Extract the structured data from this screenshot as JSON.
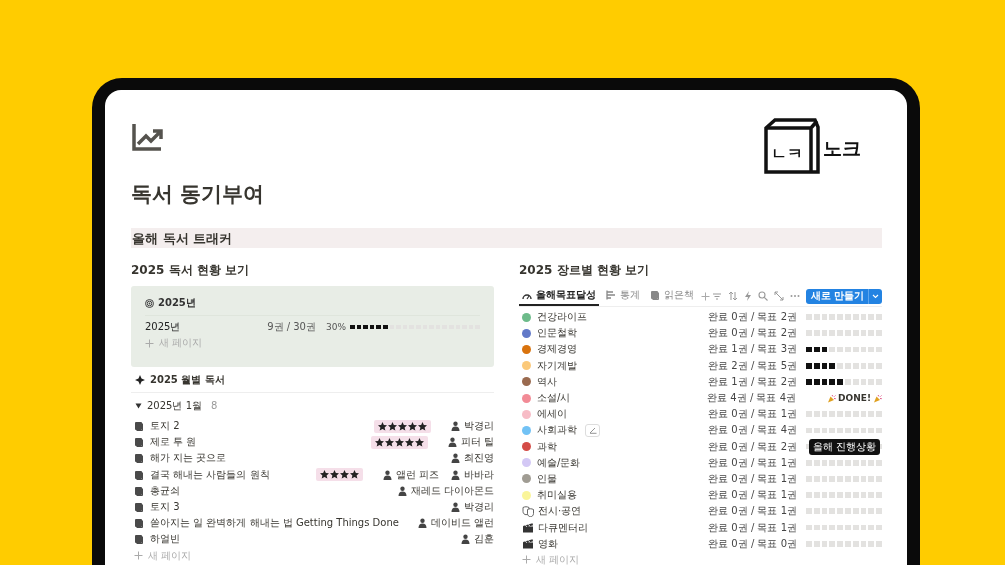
{
  "logo": {
    "symbol": "ㄴㅋ",
    "text": "노크"
  },
  "page": {
    "title": "독서 동기부여",
    "banner": "올해 독서 트래커"
  },
  "yearly": {
    "heading": "2025 독서 현황 보기",
    "view": "2025년",
    "rows": [
      {
        "name": "2025년",
        "count": "9권 / 30권",
        "percent": "30%",
        "level": 0.3
      }
    ],
    "add": "새 페이지"
  },
  "monthly": {
    "view": "2025 월별 독서",
    "groups": [
      {
        "label": "2025년 1월",
        "count": "8",
        "expanded": true,
        "books": [
          {
            "title": "토지 2",
            "stars": 5,
            "authors": [
              "박경리"
            ]
          },
          {
            "title": "제로 투 원",
            "stars": 5,
            "authors": [
              "피터 틸"
            ]
          },
          {
            "title": "해가 지는 곳으로",
            "authors": [
              "최진영"
            ]
          },
          {
            "title": "결국 해내는 사람들의 원칙",
            "stars": 4,
            "authors": [
              "앨런 피즈",
              "바바라"
            ]
          },
          {
            "title": "총균쇠",
            "authors": [
              "재레드 다이아몬드"
            ]
          },
          {
            "title": "토지 3",
            "authors": [
              "박경리"
            ]
          },
          {
            "title": "쏟아지는 일 완벽하게 해내는 법 Getting Things Done",
            "authors": [
              "데이비드 앨런"
            ]
          },
          {
            "title": "하얼빈",
            "authors": [
              "김훈"
            ]
          }
        ]
      }
    ],
    "add": "새 페이지"
  },
  "genres": {
    "heading": "2025 장르별 현황 보기",
    "tabs": [
      {
        "label": "올해목표달성",
        "selected": true
      },
      {
        "label": "통계",
        "selected": false
      },
      {
        "label": "읽은책",
        "selected": false
      }
    ],
    "new_button": "새로 만들기",
    "rows": [
      {
        "name": "건강라이프",
        "kind": "dot",
        "color": "#6dbb8a",
        "reading": "완료 0권 / 목표 2권",
        "level": 0
      },
      {
        "name": "인문철학",
        "kind": "dot",
        "color": "#6279c8",
        "reading": "완료 0권 / 목표 2권",
        "level": 0
      },
      {
        "name": "경제경영",
        "kind": "dot",
        "color": "#d9730d",
        "reading": "완료 1권 / 목표 3권",
        "level": 0.3
      },
      {
        "name": "자기계발",
        "kind": "dot",
        "color": "#fbc97a",
        "reading": "완료 2권 / 목표 5권",
        "level": 0.4
      },
      {
        "name": "역사",
        "kind": "dot",
        "color": "#9a6a4f",
        "reading": "완료 1권 / 목표 2권",
        "level": 0.5
      },
      {
        "name": "소설/시",
        "kind": "dot",
        "color": "#f28b96",
        "reading": "완료 4권 / 목표 4권",
        "done": "DONE!"
      },
      {
        "name": "에세이",
        "kind": "dot",
        "color": "#f7bcc6",
        "reading": "완료 0권 / 목표 1권",
        "level": 0
      },
      {
        "name": "사회과학",
        "kind": "dot",
        "color": "#72c2f5",
        "reading": "완료 0권 / 목표 4권",
        "level": 0,
        "hovered": true
      },
      {
        "name": "과학",
        "kind": "dot",
        "color": "#d44c47",
        "reading": "완료 0권 / 목표 2권",
        "level": 0,
        "tooltip": "올해 진행상황"
      },
      {
        "name": "예술/문화",
        "kind": "dot",
        "color": "#d3c8f5",
        "reading": "완료 0권 / 목표 1권",
        "level": 0
      },
      {
        "name": "인물",
        "kind": "dot",
        "color": "#a09c93",
        "reading": "완료 0권 / 목표 1권",
        "level": 0
      },
      {
        "name": "취미실용",
        "kind": "dot",
        "color": "#faf59a",
        "reading": "완료 0권 / 목표 1권",
        "level": 0
      },
      {
        "name": "전시·공연",
        "kind": "mask",
        "reading": "완료 0권 / 목표 1권",
        "level": 0
      },
      {
        "name": "다큐멘터리",
        "kind": "clapper",
        "reading": "완료 0권 / 목표 1권",
        "level": 0
      },
      {
        "name": "영화",
        "kind": "clapper",
        "reading": "완료 0권 / 목표 0권",
        "level": 0
      }
    ],
    "add": "새 페이지"
  }
}
